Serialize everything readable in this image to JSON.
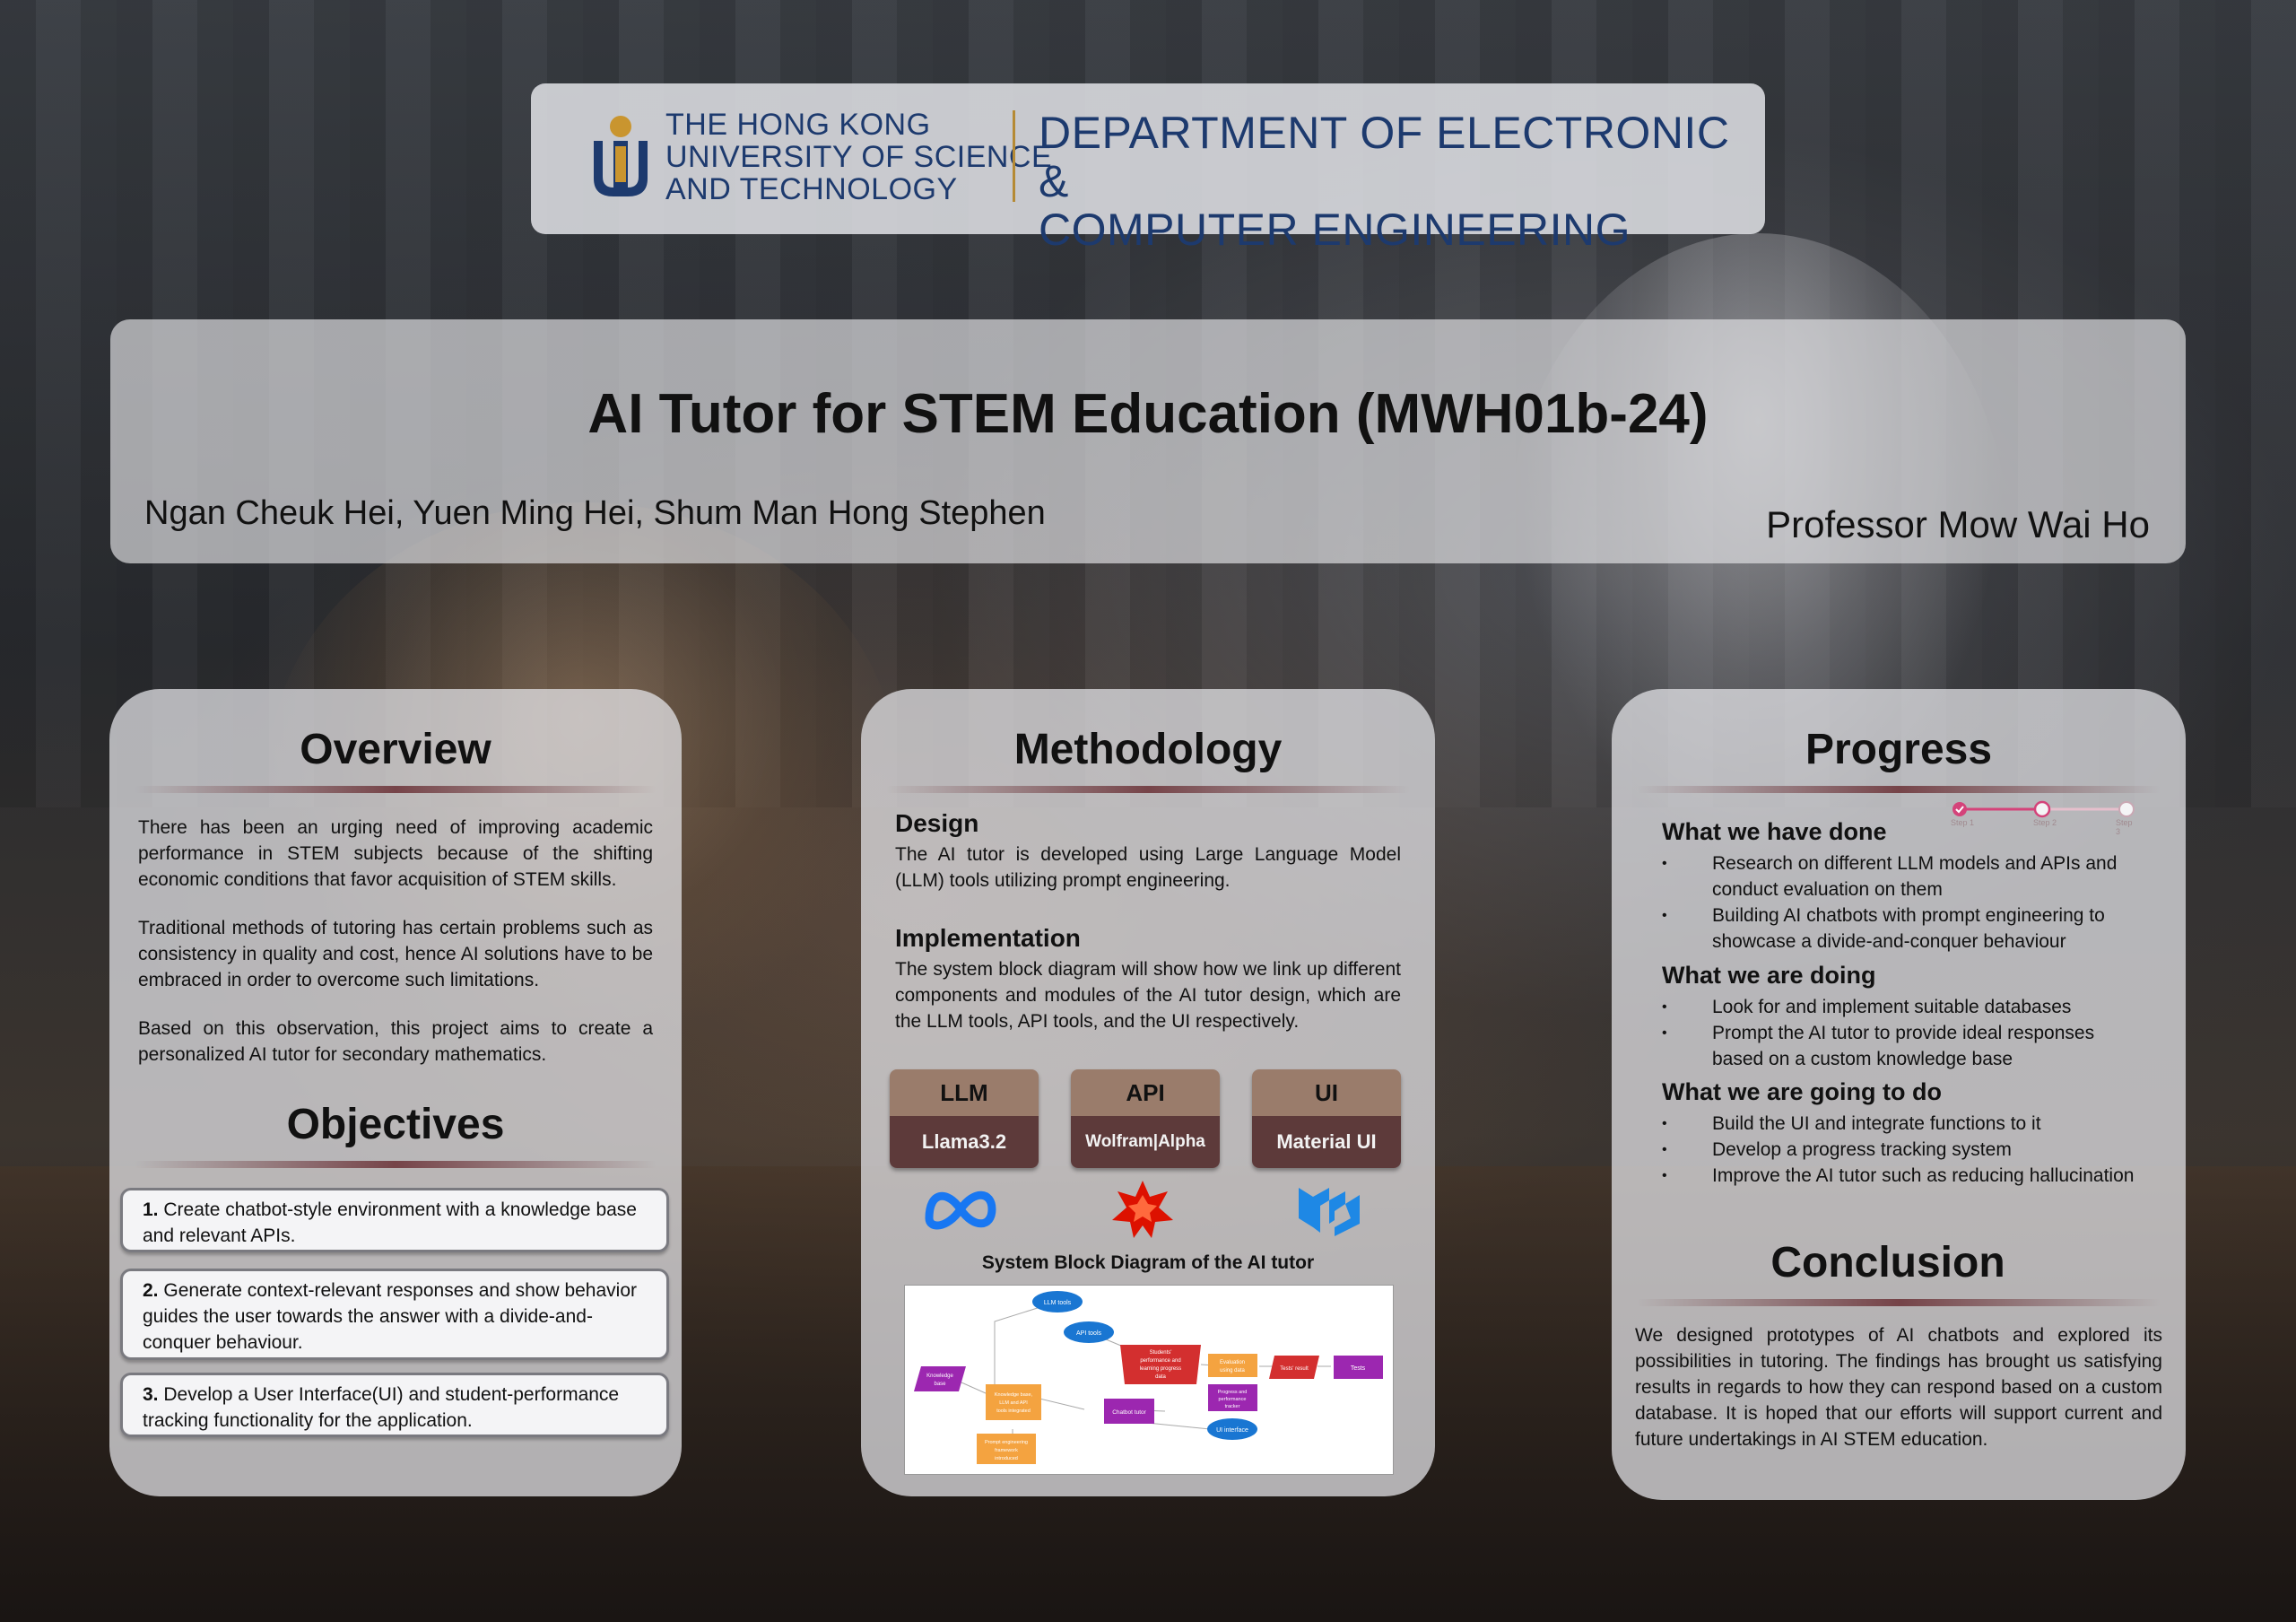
{
  "header": {
    "university": [
      "THE HONG KONG",
      "UNIVERSITY OF SCIENCE",
      "AND TECHNOLOGY"
    ],
    "department": [
      "DEPARTMENT OF ELECTRONIC &",
      "COMPUTER ENGINEERING"
    ]
  },
  "title": "AI Tutor for STEM Education (MWH01b-24)",
  "authors": "Ngan Cheuk Hei, Yuen Ming Hei, Shum Man Hong Stephen",
  "professor": "Professor Mow Wai Ho",
  "overview": {
    "heading": "Overview",
    "paragraphs": [
      "There has been an urging need of improving academic performance in STEM subjects because of the shifting economic conditions that favor acquisition of STEM skills.",
      "Traditional methods of tutoring has certain problems such as consistency in quality and cost, hence AI solutions have to be embraced in order to overcome such limitations.",
      "Based on this observation, this project aims to create a personalized AI tutor for secondary mathematics."
    ]
  },
  "objectives": {
    "heading": "Objectives",
    "items": [
      {
        "num": "1.",
        "text": "Create chatbot-style environment with a knowledge base and relevant APIs."
      },
      {
        "num": "2.",
        "text": "Generate context-relevant responses and show behavior guides the user towards the answer with a divide-and-conquer behaviour."
      },
      {
        "num": "3.",
        "text": "Develop a User Interface(UI) and student-performance tracking functionality for the application."
      }
    ]
  },
  "methodology": {
    "heading": "Methodology",
    "design_heading": "Design",
    "design_text": "The AI tutor is developed using Large Language Model (LLM) tools utilizing prompt engineering.",
    "impl_heading": "Implementation",
    "impl_text": "The system block diagram will show how we link up different components and modules of the AI tutor design, which are the LLM tools, API tools, and the UI respectively.",
    "tools": [
      {
        "category": "LLM",
        "name": "Llama3.2",
        "icon": "meta-icon"
      },
      {
        "category": "API",
        "name": "Wolfram|Alpha",
        "icon": "wolfram-icon"
      },
      {
        "category": "UI",
        "name": "Material UI",
        "icon": "mui-icon"
      }
    ],
    "diagram_caption": "System Block Diagram of the AI tutor",
    "diagram_nodes": [
      "LLM tools",
      "API tools",
      "Students' performance and learning progress data",
      "Evaluation using data",
      "Tests' result",
      "Tests",
      "Knowledge base",
      "Knowledge base, LLM and API tools integrated",
      "Chatbot tutor",
      "Progress and performance tracker",
      "UI interface",
      "Prompt engineering framework introduced"
    ]
  },
  "progress": {
    "heading": "Progress",
    "steps": [
      "Step 1",
      "Step 2",
      "Step 3"
    ],
    "done_heading": "What we have done",
    "done_items": [
      "Research on different LLM models and APIs and conduct evaluation on them",
      "Building AI chatbots with prompt engineering to showcase a divide-and-conquer behaviour"
    ],
    "doing_heading": "What we are doing",
    "doing_items": [
      "Look for and implement suitable databases",
      "Prompt the AI tutor to provide ideal responses based on a custom knowledge base"
    ],
    "todo_heading": "What we are going to do",
    "todo_items": [
      "Build the UI and integrate functions to it",
      "Develop a progress tracking system",
      "Improve the AI tutor such as reducing hallucination"
    ]
  },
  "conclusion": {
    "heading": "Conclusion",
    "text": "We designed prototypes of AI chatbots and explored its possibilities in tutoring. The findings has brought us satisfying results in regards to how they can respond based on a custom database. It is hoped that our efforts will support current and future undertakings in AI STEM education."
  },
  "colors": {
    "navy": "#1d3a6e",
    "gold": "#b58a35",
    "chip_top": "#9a7c6b",
    "chip_bottom": "#5d3a3a",
    "accent_pink": "#d4437a"
  }
}
